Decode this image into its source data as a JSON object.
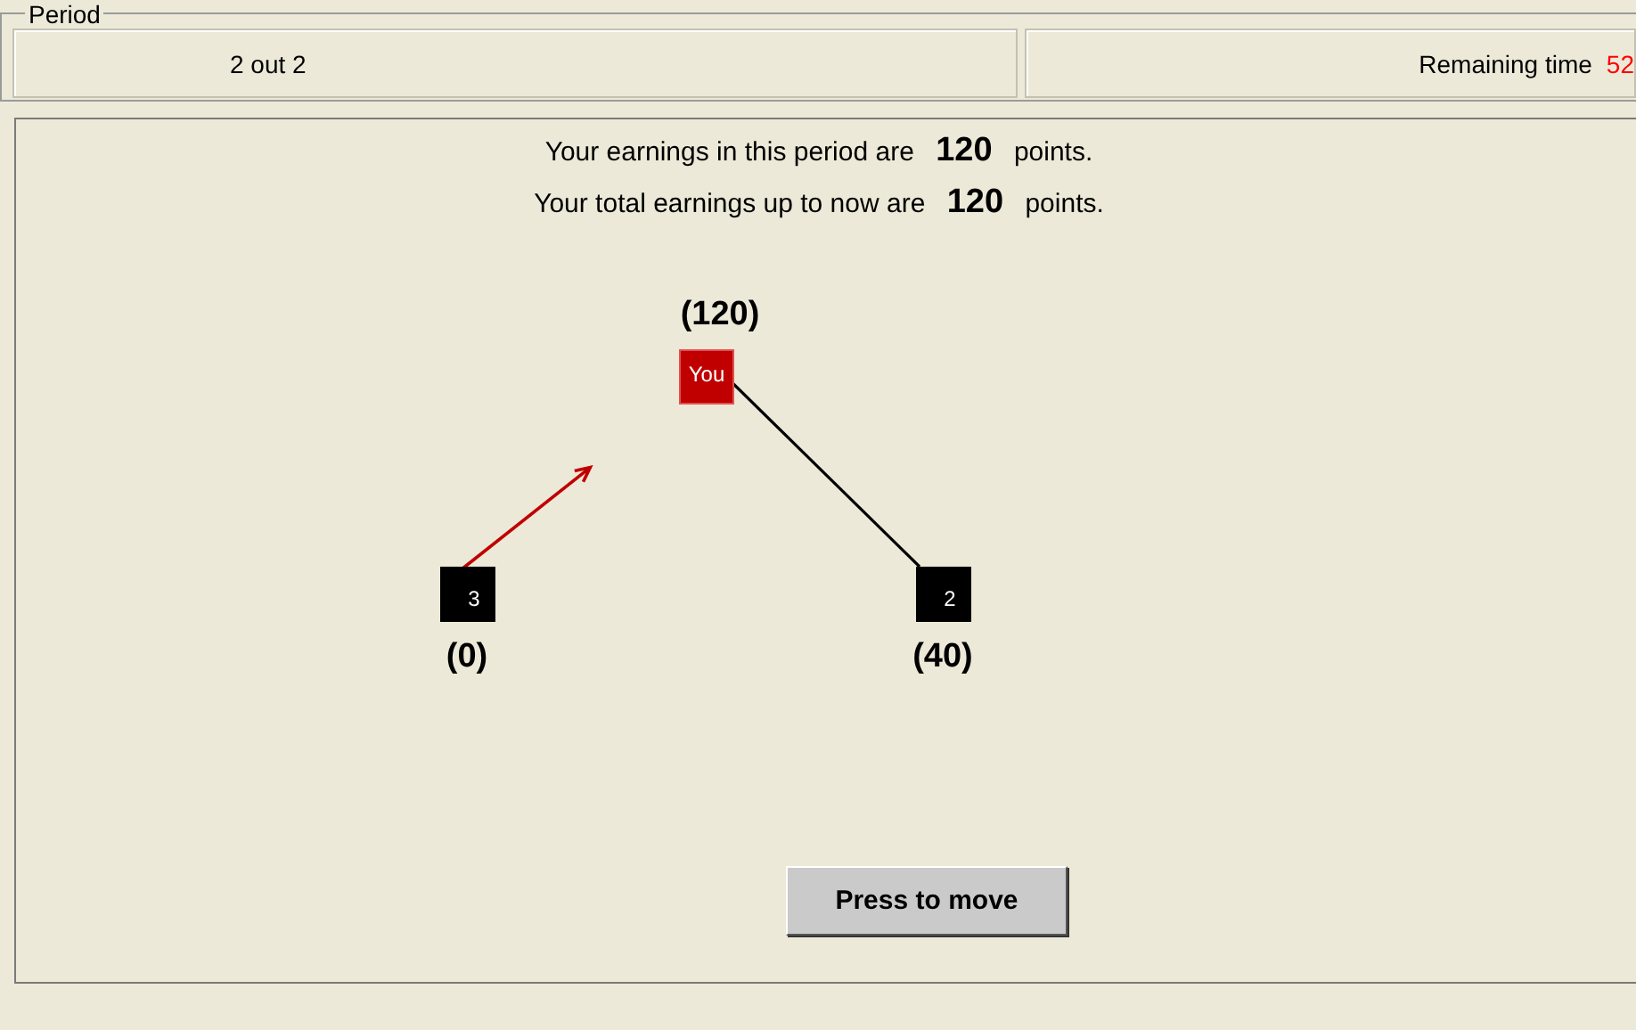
{
  "header": {
    "period_label": "Period",
    "period_value": "2 out 2",
    "remaining_label": "Remaining time",
    "remaining_value": "52"
  },
  "earnings": [
    "Your earnings in this period are **120** points.",
    "Your total earnings up to now are **120** points."
  ],
  "network": {
    "nodes": [
      {
        "label": "You",
        "payoff": "(120)",
        "color": "#c00000"
      },
      {
        "label": "3",
        "payoff": "(0)",
        "color": "#000000"
      },
      {
        "label": "2",
        "payoff": "(40)",
        "color": "#000000"
      }
    ],
    "links": [
      {
        "kind": "line"
      },
      {
        "kind": "arrow"
      }
    ]
  },
  "button": "Press to move"
}
